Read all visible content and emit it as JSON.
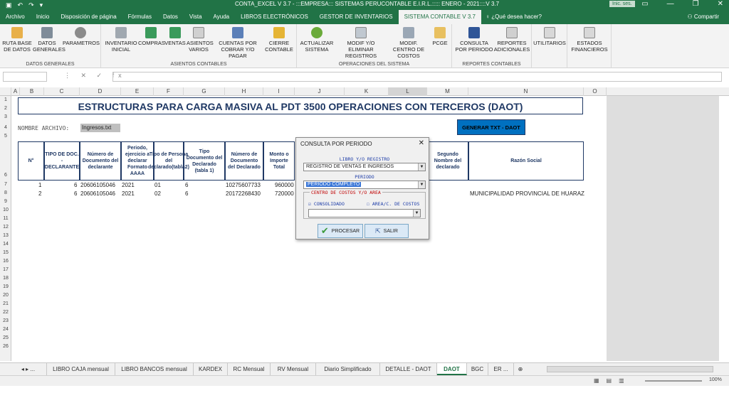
{
  "window": {
    "title": "CONTA_EXCEL V 3.7   -   :::EMPRESA::: SISTEMAS PERUCONTABLE E.I.R.L.::::: ENERO - 2021::::V 3.7",
    "signin": "Inic. ses."
  },
  "tabs": [
    "Archivo",
    "Inicio",
    "Disposición de página",
    "Fórmulas",
    "Datos",
    "Vista",
    "Ayuda",
    "LIBROS ELECTRÓNICOS",
    "GESTOR DE INVENTARIOS",
    "SISTEMA CONTABLE V 3.7"
  ],
  "tell_me": "¿Qué desea hacer?",
  "share": "Compartir",
  "ribbon": {
    "groups": [
      "DATOS GENERALES",
      "ASIENTOS CONTABLES",
      "OPERACIONES DEL SISTEMA",
      "REPORTES CONTABLES"
    ],
    "buttons": [
      "RUTA BASE DE DATOS",
      "DATOS GENERALES",
      "PARAMETROS",
      "INVENTARIO INICIAL",
      "COMPRAS",
      "VENTAS",
      "ASIENTOS VARIOS",
      "CUENTAS POR COBRAR Y/O PAGAR",
      "CIERRE CONTABLE",
      "ACTUALIZAR SISTEMA",
      "MODIF Y/O ELIMINAR REGISTROS",
      "MODIF. CENTRO DE COSTOS",
      "PCGE",
      "CONSULTA POR PERIODO",
      "REPORTES ADICIONALES",
      "UTILITARIOS",
      "ESTADOS FINANCIEROS"
    ],
    "colors": {
      "excel_green": "#217346",
      "ribbon_bg": "#f3f3f3"
    }
  },
  "formula_bar": {
    "fx": "fx",
    "value": ""
  },
  "columns": [
    "A",
    "B",
    "C",
    "D",
    "E",
    "F",
    "G",
    "H",
    "I",
    "J",
    "K",
    "L",
    "M",
    "N",
    "O"
  ],
  "rows": [
    "1",
    "2",
    "3",
    "4",
    "5",
    "6",
    "7",
    "8",
    "9",
    "10",
    "11",
    "12",
    "13",
    "14",
    "15",
    "16",
    "17",
    "18",
    "19",
    "20",
    "21",
    "22",
    "23",
    "24",
    "25",
    "26"
  ],
  "sheet": {
    "title": "ESTRUCTURAS PARA CARGA MASIVA  AL PDT 3500 OPERACIONES CON TERCEROS (DAOT)",
    "nombre_label": "NOMBRE ARCHIVO:",
    "filename": "Ingresos.txt",
    "generate_button": "GENERAR TXT - DAOT",
    "headers": [
      "N°",
      "TIPO DE DOC. - DECLARANTE",
      "Número de Documento del declarante",
      "Periodo, ejercicio a declarar Formato AAAA",
      "Tipo de Persona del declarado(tabla2)",
      "Tipo Documento del Declarado (tabla 1)",
      "Número de Documento del Declarado",
      "Monto o Importe Total",
      "Segundo Nombre del declarado",
      "Razón Social"
    ],
    "rows": [
      {
        "n": "1",
        "tipo": "6",
        "doc": "20606105046",
        "periodo": "2021",
        "persona": "01",
        "tipodoc": "6",
        "numdoc": "10275607733",
        "monto": "960000",
        "razon": ""
      },
      {
        "n": "2",
        "tipo": "6",
        "doc": "20606105046",
        "periodo": "2021",
        "persona": "02",
        "tipodoc": "6",
        "numdoc": "20172268430",
        "monto": "720000",
        "razon": "MUNICIPALIDAD PROVINCIAL DE HUARAZ"
      }
    ]
  },
  "dialog": {
    "title": "CONSULTA POR PERIODO",
    "libro_label": "LIBRO Y/O REGISTRO",
    "libro_value": "REGISTRO DE VENTAS E INGRESOS",
    "periodo_label": "PERIODO",
    "periodo_value": "PERIODO COMPLETO",
    "centro_label": "CENTRO DE COSTOS Y/O AREA",
    "consolidado": "CONSOLIDADO",
    "area": "AREA/C. DE COSTOS",
    "procesar": "PROCESAR",
    "salir": "SALIR"
  },
  "sheet_tabs": [
    "...",
    "LIBRO CAJA mensual",
    "LIBRO BANCOS mensual",
    "KARDEX",
    "RC Mensual",
    "RV Mensual",
    "Diario Simplificado",
    "DETALLE - DAOT",
    "DAOT",
    "BGC",
    "ER ..."
  ],
  "status": {
    "zoom": "100%"
  }
}
